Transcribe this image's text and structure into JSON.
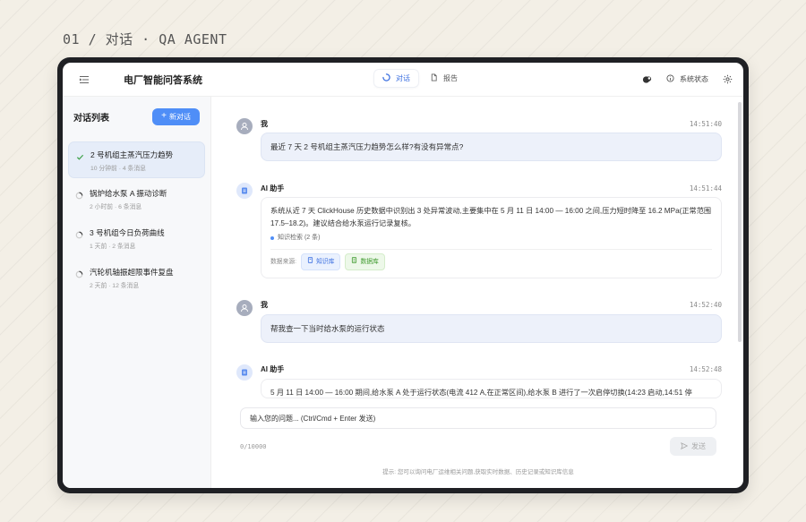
{
  "caption": "01 / 对话 · QA AGENT",
  "app": {
    "title": "电厂智能问答系统"
  },
  "tabs": [
    {
      "label": "对话",
      "active": true
    },
    {
      "label": "报告",
      "active": false
    }
  ],
  "top_right": {
    "status_label": "系统状态"
  },
  "sidebar": {
    "title": "对话列表",
    "new_button": "新对话",
    "items": [
      {
        "title": "2 号机组主蒸汽压力趋势",
        "meta": "10 分钟前 · 4 条消息",
        "state": "done"
      },
      {
        "title": "锅炉给水泵 A 振动诊断",
        "meta": "2 小时前 · 6 条消息",
        "state": "loading"
      },
      {
        "title": "3 号机组今日负荷曲线",
        "meta": "1 天前 · 2 条消息",
        "state": "loading"
      },
      {
        "title": "汽轮机轴振超限事件复盘",
        "meta": "2 天前 · 12 条消息",
        "state": "loading"
      }
    ]
  },
  "messages": [
    {
      "role": "user",
      "author": "我",
      "time": "14:51:40",
      "text": "最近 7 天 2 号机组主蒸汽压力趋势怎么样?有没有异常点?"
    },
    {
      "role": "ai",
      "author": "AI 助手",
      "time": "14:51:44",
      "text": "系统从近 7 天 ClickHouse 历史数据中识别出 3 处异常波动,主要集中在 5 月 11 日 14:00 — 16:00 之间,压力短时降至 16.2 MPa(正常范围 17.5–18.2)。建议结合给水泵运行记录复核。",
      "kb": "知识检索 (2 条)",
      "sources_label": "数据来源:",
      "sources": [
        "知识库",
        "数据库"
      ]
    },
    {
      "role": "user",
      "author": "我",
      "time": "14:52:40",
      "text": "帮我查一下当时给水泵的运行状态"
    },
    {
      "role": "ai",
      "author": "AI 助手",
      "time": "14:52:48",
      "text": "5 月 11 日 14:00 — 16:00 期间,给水泵 A 处于运行状态(电流 412 A,在正常区间),给水泵 B 进行了一次启停切换(14:23 启动,14:51 停"
    }
  ],
  "composer": {
    "placeholder": "输入您的问题... (Ctrl/Cmd + Enter 发送)",
    "counter": "0/10000",
    "send_label": "发送",
    "hint": "提示: 您可以询问电厂运维相关问题,获取实时数据、历史记录或知识库信息"
  },
  "colors": {
    "accent": "#4f8ef7",
    "background": "#f3efe6"
  }
}
